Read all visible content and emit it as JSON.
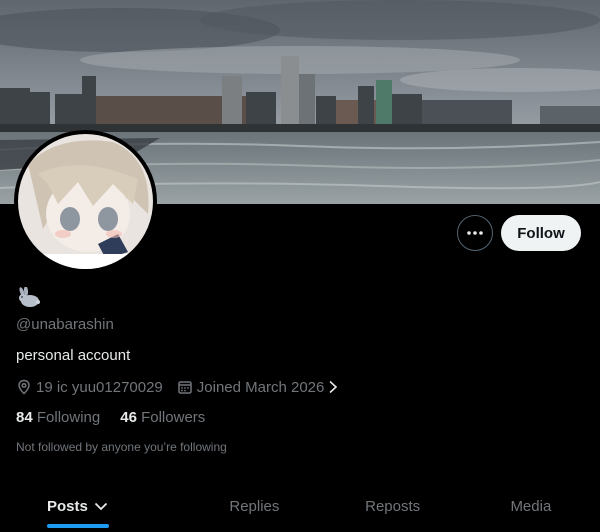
{
  "profile": {
    "handle": "@unabarashin",
    "bio": "personal account",
    "location": "19 ic yuu01270029",
    "joined": "Joined March 2026",
    "following_count": "84",
    "following_label": "Following",
    "followers_count": "46",
    "followers_label": "Followers",
    "not_followed_note": "Not followed by anyone you’re following"
  },
  "actions": {
    "follow_label": "Follow"
  },
  "tabs": [
    {
      "label": "Posts",
      "active": true
    },
    {
      "label": "Replies",
      "active": false
    },
    {
      "label": "Reposts",
      "active": false
    },
    {
      "label": "Media",
      "active": false
    }
  ],
  "colors": {
    "accent": "#1d9bf0",
    "muted": "#71767b",
    "text": "#e7e9ea",
    "background": "#000000"
  }
}
